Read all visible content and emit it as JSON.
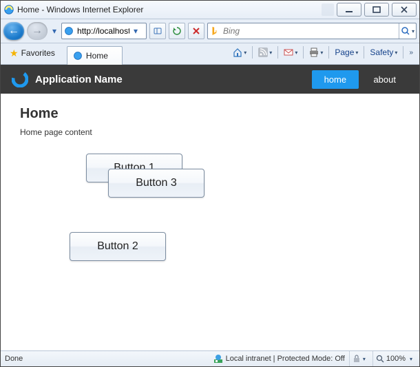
{
  "window": {
    "title": "Home - Windows Internet Explorer",
    "buttons": {
      "min": "min",
      "max": "max",
      "close": "close"
    }
  },
  "nav": {
    "url": "http://localhost:",
    "refresh_icon": "refresh",
    "stop_icon": "stop"
  },
  "search": {
    "placeholder": "Bing",
    "engine_icon": "bing"
  },
  "favorites": {
    "label": "Favorites"
  },
  "tab": {
    "label": "Home"
  },
  "cmdbar": {
    "page_label": "Page",
    "safety_label": "Safety",
    "icons": {
      "home": "home",
      "feed": "feed",
      "mail": "mail",
      "print": "print"
    }
  },
  "app": {
    "title": "Application Name",
    "nav": {
      "home": "home",
      "about": "about"
    }
  },
  "page": {
    "heading": "Home",
    "body": "Home page content",
    "buttons": {
      "b1": "Button 1",
      "b2": "Button 2",
      "b3": "Button 3"
    }
  },
  "status": {
    "left": "Done",
    "zone": "Local intranet | Protected Mode: Off",
    "zoom": "100%"
  }
}
